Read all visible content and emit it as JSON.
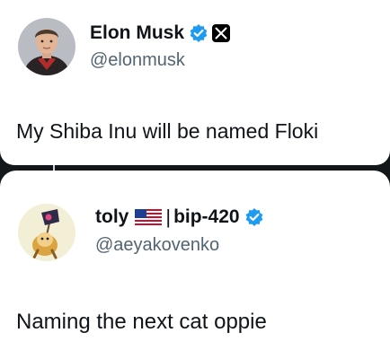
{
  "tweets": [
    {
      "author_name": "Elon Musk",
      "handle": "@elonmusk",
      "text": "My Shiba Inu will be named Floki",
      "verified_badge_icon": "verified-badge-icon",
      "affiliate_icon": "x-logo-icon"
    },
    {
      "author_name": "toly",
      "flag_icon": "us-flag-icon",
      "name_separator": "|",
      "name_suffix": "bip-420",
      "handle": "@aeyakovenko",
      "text": "Naming the next cat oppie",
      "verified_badge_icon": "verified-badge-icon"
    }
  ],
  "colors": {
    "background": "#14171a",
    "card": "#ffffff",
    "text_primary": "#0f1419",
    "text_secondary": "#536471",
    "verified_blue": "#1d9bf0"
  }
}
